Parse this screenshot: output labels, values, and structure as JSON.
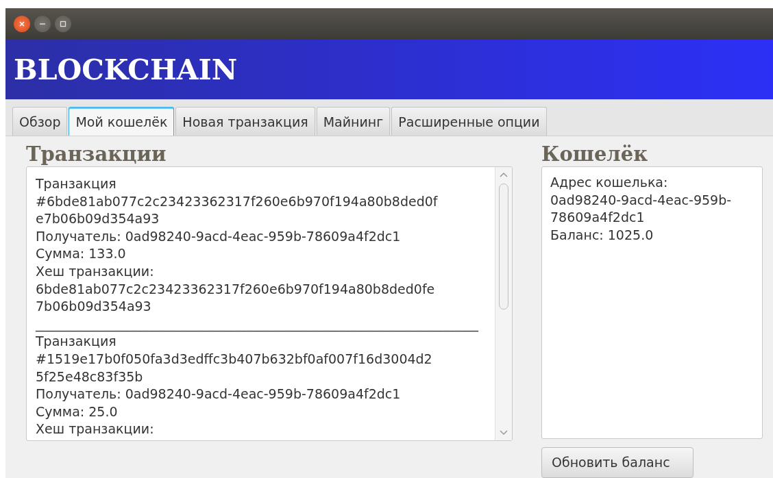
{
  "header": {
    "title": "BLOCKCHAIN"
  },
  "tabs": [
    {
      "label": "Обзор",
      "selected": false
    },
    {
      "label": "Мой кошелёк",
      "selected": true
    },
    {
      "label": "Новая транзакция",
      "selected": false
    },
    {
      "label": "Майнинг",
      "selected": false
    },
    {
      "label": "Расширенные опции",
      "selected": false
    }
  ],
  "transactions": {
    "title": "Транзакции",
    "entries": [
      {
        "lines": [
          "Транзакция",
          "#6bde81ab077c2c23423362317f260e6b970f194a80b8ded0f",
          "e7b06b09d354a93",
          "Получатель: 0ad98240-9acd-4eac-959b-78609a4f2dc1",
          "Сумма: 133.0",
          "Хеш транзакции:",
          "6bde81ab077c2c23423362317f260e6b970f194a80b8ded0fe",
          "7b06b09d354a93"
        ]
      },
      {
        "lines": [
          "____________________________________________________________________"
        ]
      },
      {
        "lines": [
          "Транзакция",
          "#1519e17b0f050fa3d3edffc3b407b632bf0af007f16d3004d2",
          "5f25e48c83f35b",
          "Получатель: 0ad98240-9acd-4eac-959b-78609a4f2dc1",
          "Сумма: 25.0",
          "Хеш транзакции:"
        ]
      }
    ]
  },
  "wallet": {
    "title": "Кошелёк",
    "lines": [
      "Адрес кошелька:",
      "0ad98240-9acd-4eac-959b-",
      "78609a4f2dc1",
      "Баланс: 1025.0"
    ],
    "button": "Обновить баланс"
  }
}
